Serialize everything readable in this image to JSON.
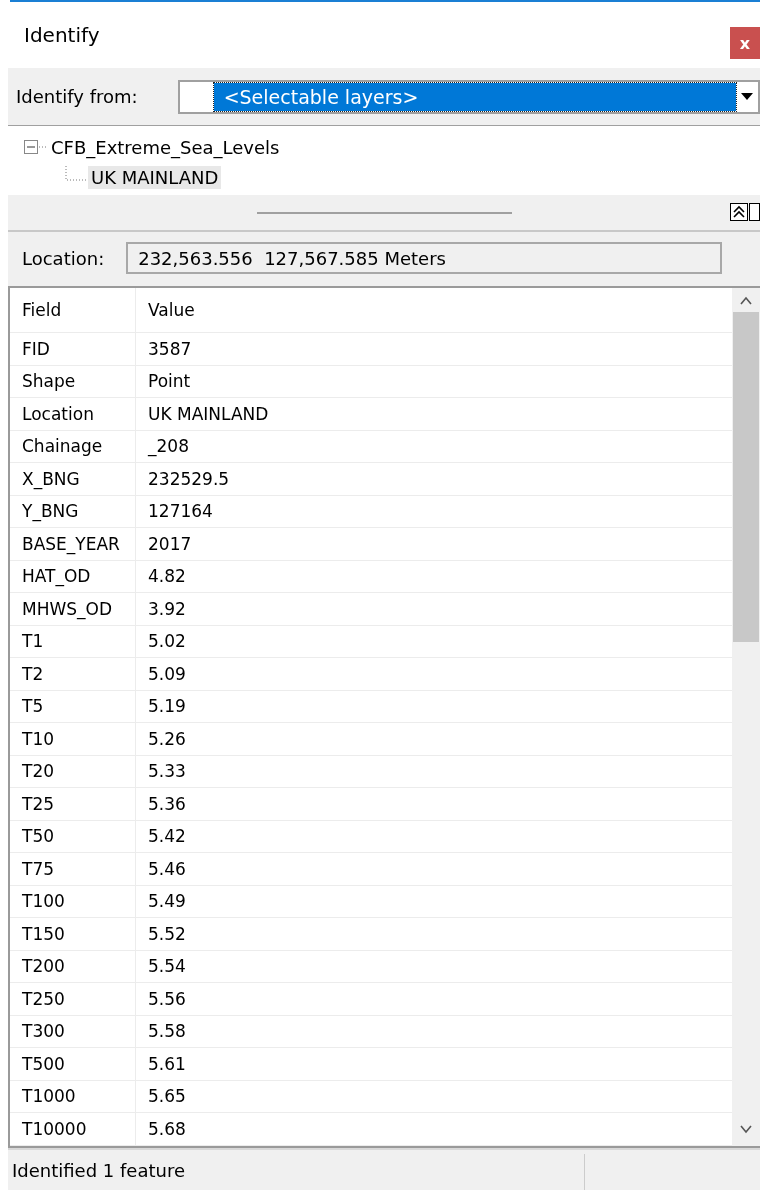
{
  "window": {
    "title": "Identify",
    "close": "x"
  },
  "identify_from": {
    "label": "Identify from:",
    "value": "<Selectable layers>"
  },
  "tree": [
    {
      "label": "CFB_Extreme_Sea_Levels",
      "expanded": true,
      "selected": false,
      "children": [
        {
          "label": "UK MAINLAND",
          "selected": true
        }
      ]
    }
  ],
  "location": {
    "label": "Location:",
    "value": "232,563.556  127,567.585 Meters"
  },
  "table": {
    "columns": [
      "Field",
      "Value"
    ],
    "rows": [
      [
        "FID",
        "3587"
      ],
      [
        "Shape",
        "Point"
      ],
      [
        "Location",
        "UK MAINLAND"
      ],
      [
        "Chainage",
        "_208"
      ],
      [
        "X_BNG",
        "232529.5"
      ],
      [
        "Y_BNG",
        "127164"
      ],
      [
        "BASE_YEAR",
        "2017"
      ],
      [
        "HAT_OD",
        "4.82"
      ],
      [
        "MHWS_OD",
        "3.92"
      ],
      [
        "T1",
        "5.02"
      ],
      [
        "T2",
        "5.09"
      ],
      [
        "T5",
        "5.19"
      ],
      [
        "T10",
        "5.26"
      ],
      [
        "T20",
        "5.33"
      ],
      [
        "T25",
        "5.36"
      ],
      [
        "T50",
        "5.42"
      ],
      [
        "T75",
        "5.46"
      ],
      [
        "T100",
        "5.49"
      ],
      [
        "T150",
        "5.52"
      ],
      [
        "T200",
        "5.54"
      ],
      [
        "T250",
        "5.56"
      ],
      [
        "T300",
        "5.58"
      ],
      [
        "T500",
        "5.61"
      ],
      [
        "T1000",
        "5.65"
      ],
      [
        "T10000",
        "5.68"
      ]
    ]
  },
  "status_bar": {
    "text": "Identified 1 feature"
  }
}
